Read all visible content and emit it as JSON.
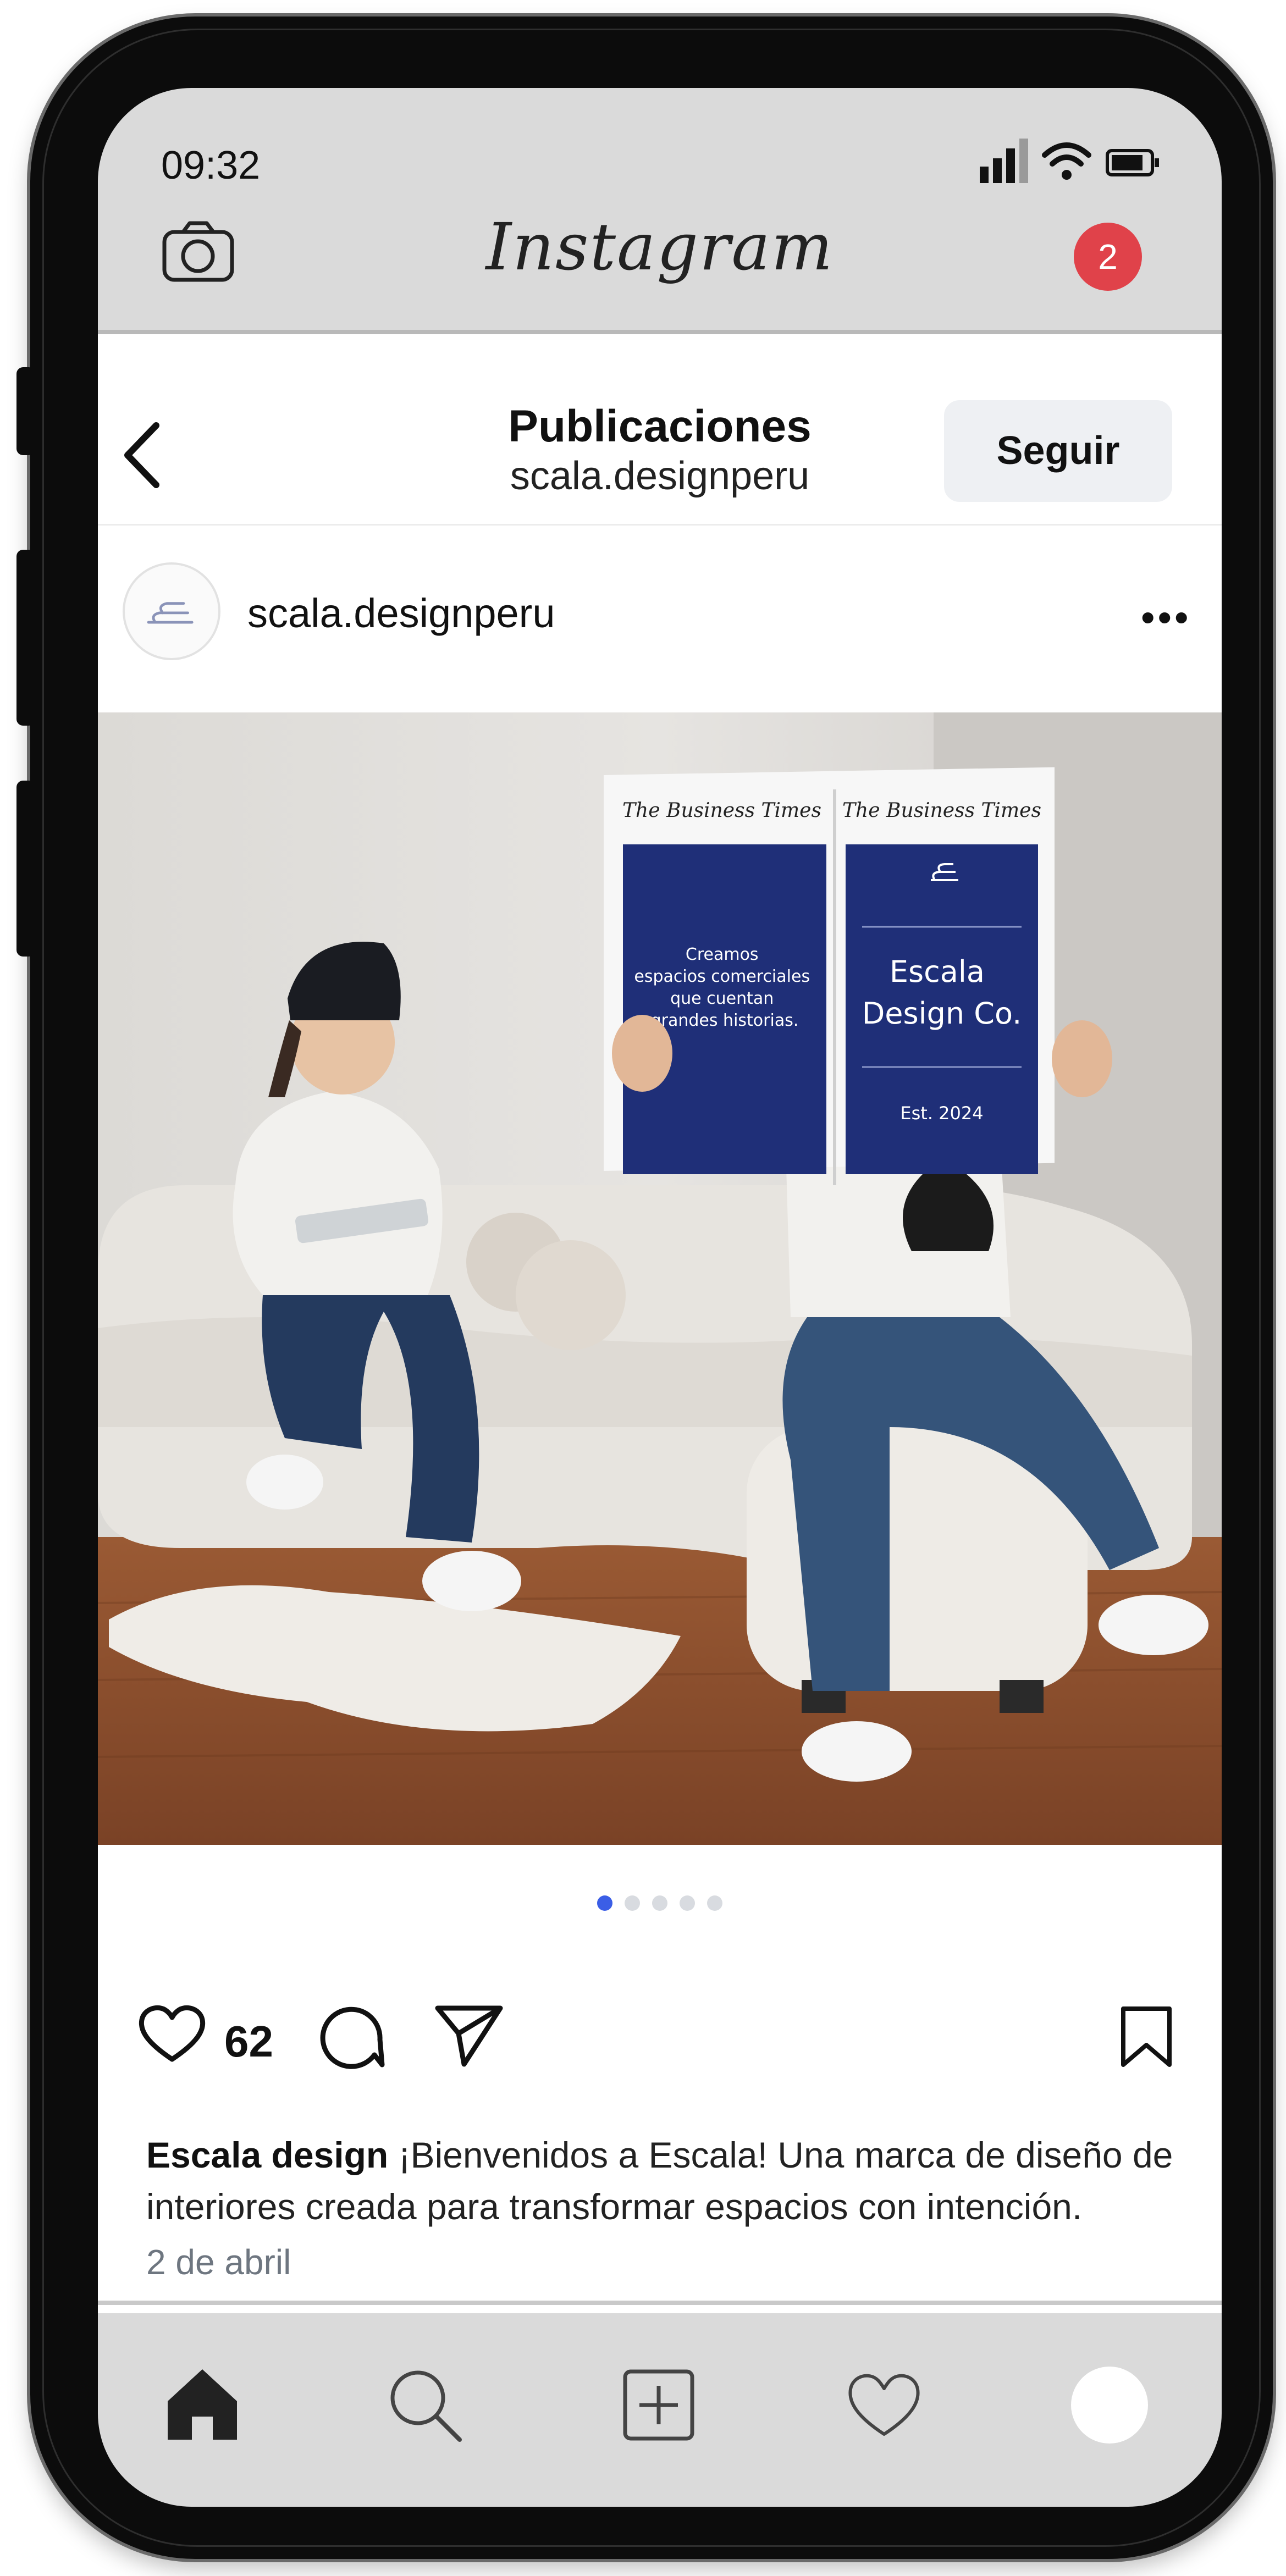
{
  "status_bar": {
    "time": "09:32"
  },
  "app_bar": {
    "logo": "Instagram",
    "notification_count": "2",
    "camera_icon": "camera-icon"
  },
  "header": {
    "title": "Publicaciones",
    "subtitle": "scala.designperu",
    "follow_label": "Seguir",
    "back_icon": "chevron-left-icon"
  },
  "post": {
    "username": "scala.designperu",
    "more_icon": "more-horizontal-icon",
    "image": {
      "newspaper_masthead": "The Business Times",
      "newspaper_left_text": "Creamos espacios comerciales que cuentan grandes historias.",
      "newspaper_right_title": "Escala Design Co.",
      "newspaper_right_sub": "Est. 2024"
    },
    "carousel": {
      "count": 5,
      "active": 0
    },
    "likes": "62",
    "caption_author": "Escala design",
    "caption_text": "¡Bienvenidos a Escala! Una marca de diseño de interiores creada para transformar espacios con intención.",
    "date": "2 de abril"
  },
  "bottom_nav": [
    "home-icon",
    "search-icon",
    "add-post-icon",
    "heart-icon",
    "profile-avatar"
  ],
  "colors": {
    "accent_blue": "#3b5ee6",
    "badge_red": "#e0424a",
    "navy": "#1f2f78"
  }
}
